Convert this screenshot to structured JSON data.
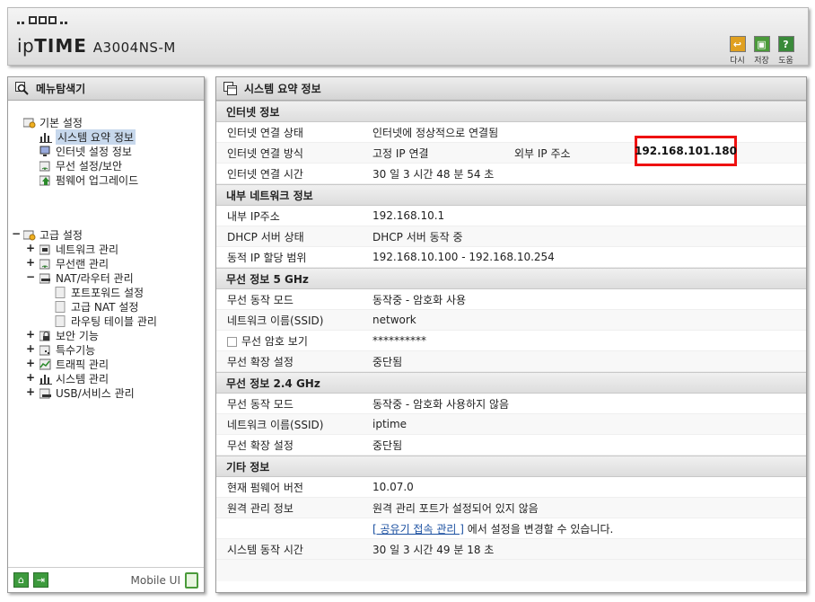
{
  "header": {
    "brand_prefix": "ip",
    "brand_bold": "TIME",
    "model": "A3004NS-M",
    "tools": [
      {
        "label": "다시",
        "icon": "undo-icon",
        "color": "#e0a020"
      },
      {
        "label": "저장",
        "icon": "save-icon",
        "color": "#4a9a3a"
      },
      {
        "label": "도움",
        "icon": "help-icon",
        "color": "#3a8a3a"
      }
    ]
  },
  "sidebar": {
    "title": "메뉴탐색기",
    "basic": {
      "label": "기본 설정",
      "items": [
        "시스템 요약 정보",
        "인터넷 설정 정보",
        "무선 설정/보안",
        "펌웨어 업그레이드"
      ]
    },
    "advanced": {
      "label": "고급 설정",
      "items": [
        "네트워크 관리",
        "무선랜 관리",
        "NAT/라우터 관리",
        "포트포워드 설정",
        "고급 NAT 설정",
        "라우팅 테이블 관리",
        "보안 기능",
        "특수기능",
        "트래픽 관리",
        "시스템 관리",
        "USB/서비스 관리"
      ]
    },
    "mobile_label": "Mobile UI"
  },
  "main": {
    "title": "시스템 요약 정보",
    "sections": {
      "internet": {
        "title": "인터넷 정보",
        "status_label": "인터넷 연결 상태",
        "status_value": "인터넷에 정상적으로 연결됨",
        "method_label": "인터넷 연결 방식",
        "method_value": "고정 IP 연결",
        "ext_ip_label": "외부 IP 주소",
        "ext_ip_value": "192.168.101.180",
        "time_label": "인터넷 연결 시간",
        "time_value": "30 일 3 시간 48 분 54 초"
      },
      "lan": {
        "title": "내부 네트워크 정보",
        "ip_label": "내부 IP주소",
        "ip_value": "192.168.10.1",
        "dhcp_label": "DHCP 서버 상태",
        "dhcp_value": "DHCP 서버 동작 중",
        "range_label": "동적 IP 할당 범위",
        "range_value": "192.168.10.100 -  192.168.10.254"
      },
      "wifi5": {
        "title": "무선 정보 5 GHz",
        "mode_label": "무선 동작 모드",
        "mode_value": "동작중 - 암호화 사용",
        "ssid_label": "네트워크 이름(SSID)",
        "ssid_value": "network",
        "pw_label": "무선 암호 보기",
        "pw_value": "**********",
        "ext_label": "무선 확장 설정",
        "ext_value": "중단됨"
      },
      "wifi24": {
        "title": "무선 정보 2.4 GHz",
        "mode_label": "무선 동작 모드",
        "mode_value": "동작중 - 암호화 사용하지 않음",
        "ssid_label": "네트워크 이름(SSID)",
        "ssid_value": "iptime",
        "ext_label": "무선 확장 설정",
        "ext_value": "중단됨"
      },
      "etc": {
        "title": "기타 정보",
        "fw_label": "현재 펌웨어 버전",
        "fw_value": "10.07.0",
        "remote_label": "원격 관리 정보",
        "remote_value": "원격 관리 포트가 설정되어 있지 않음",
        "remote_link": "[ 공유기 접속 관리 ]",
        "remote_note": "에서 설정을 변경할 수 있습니다.",
        "uptime_label": "시스템 동작 시간",
        "uptime_value": "30 일 3 시간 49 분 18 초"
      }
    }
  }
}
